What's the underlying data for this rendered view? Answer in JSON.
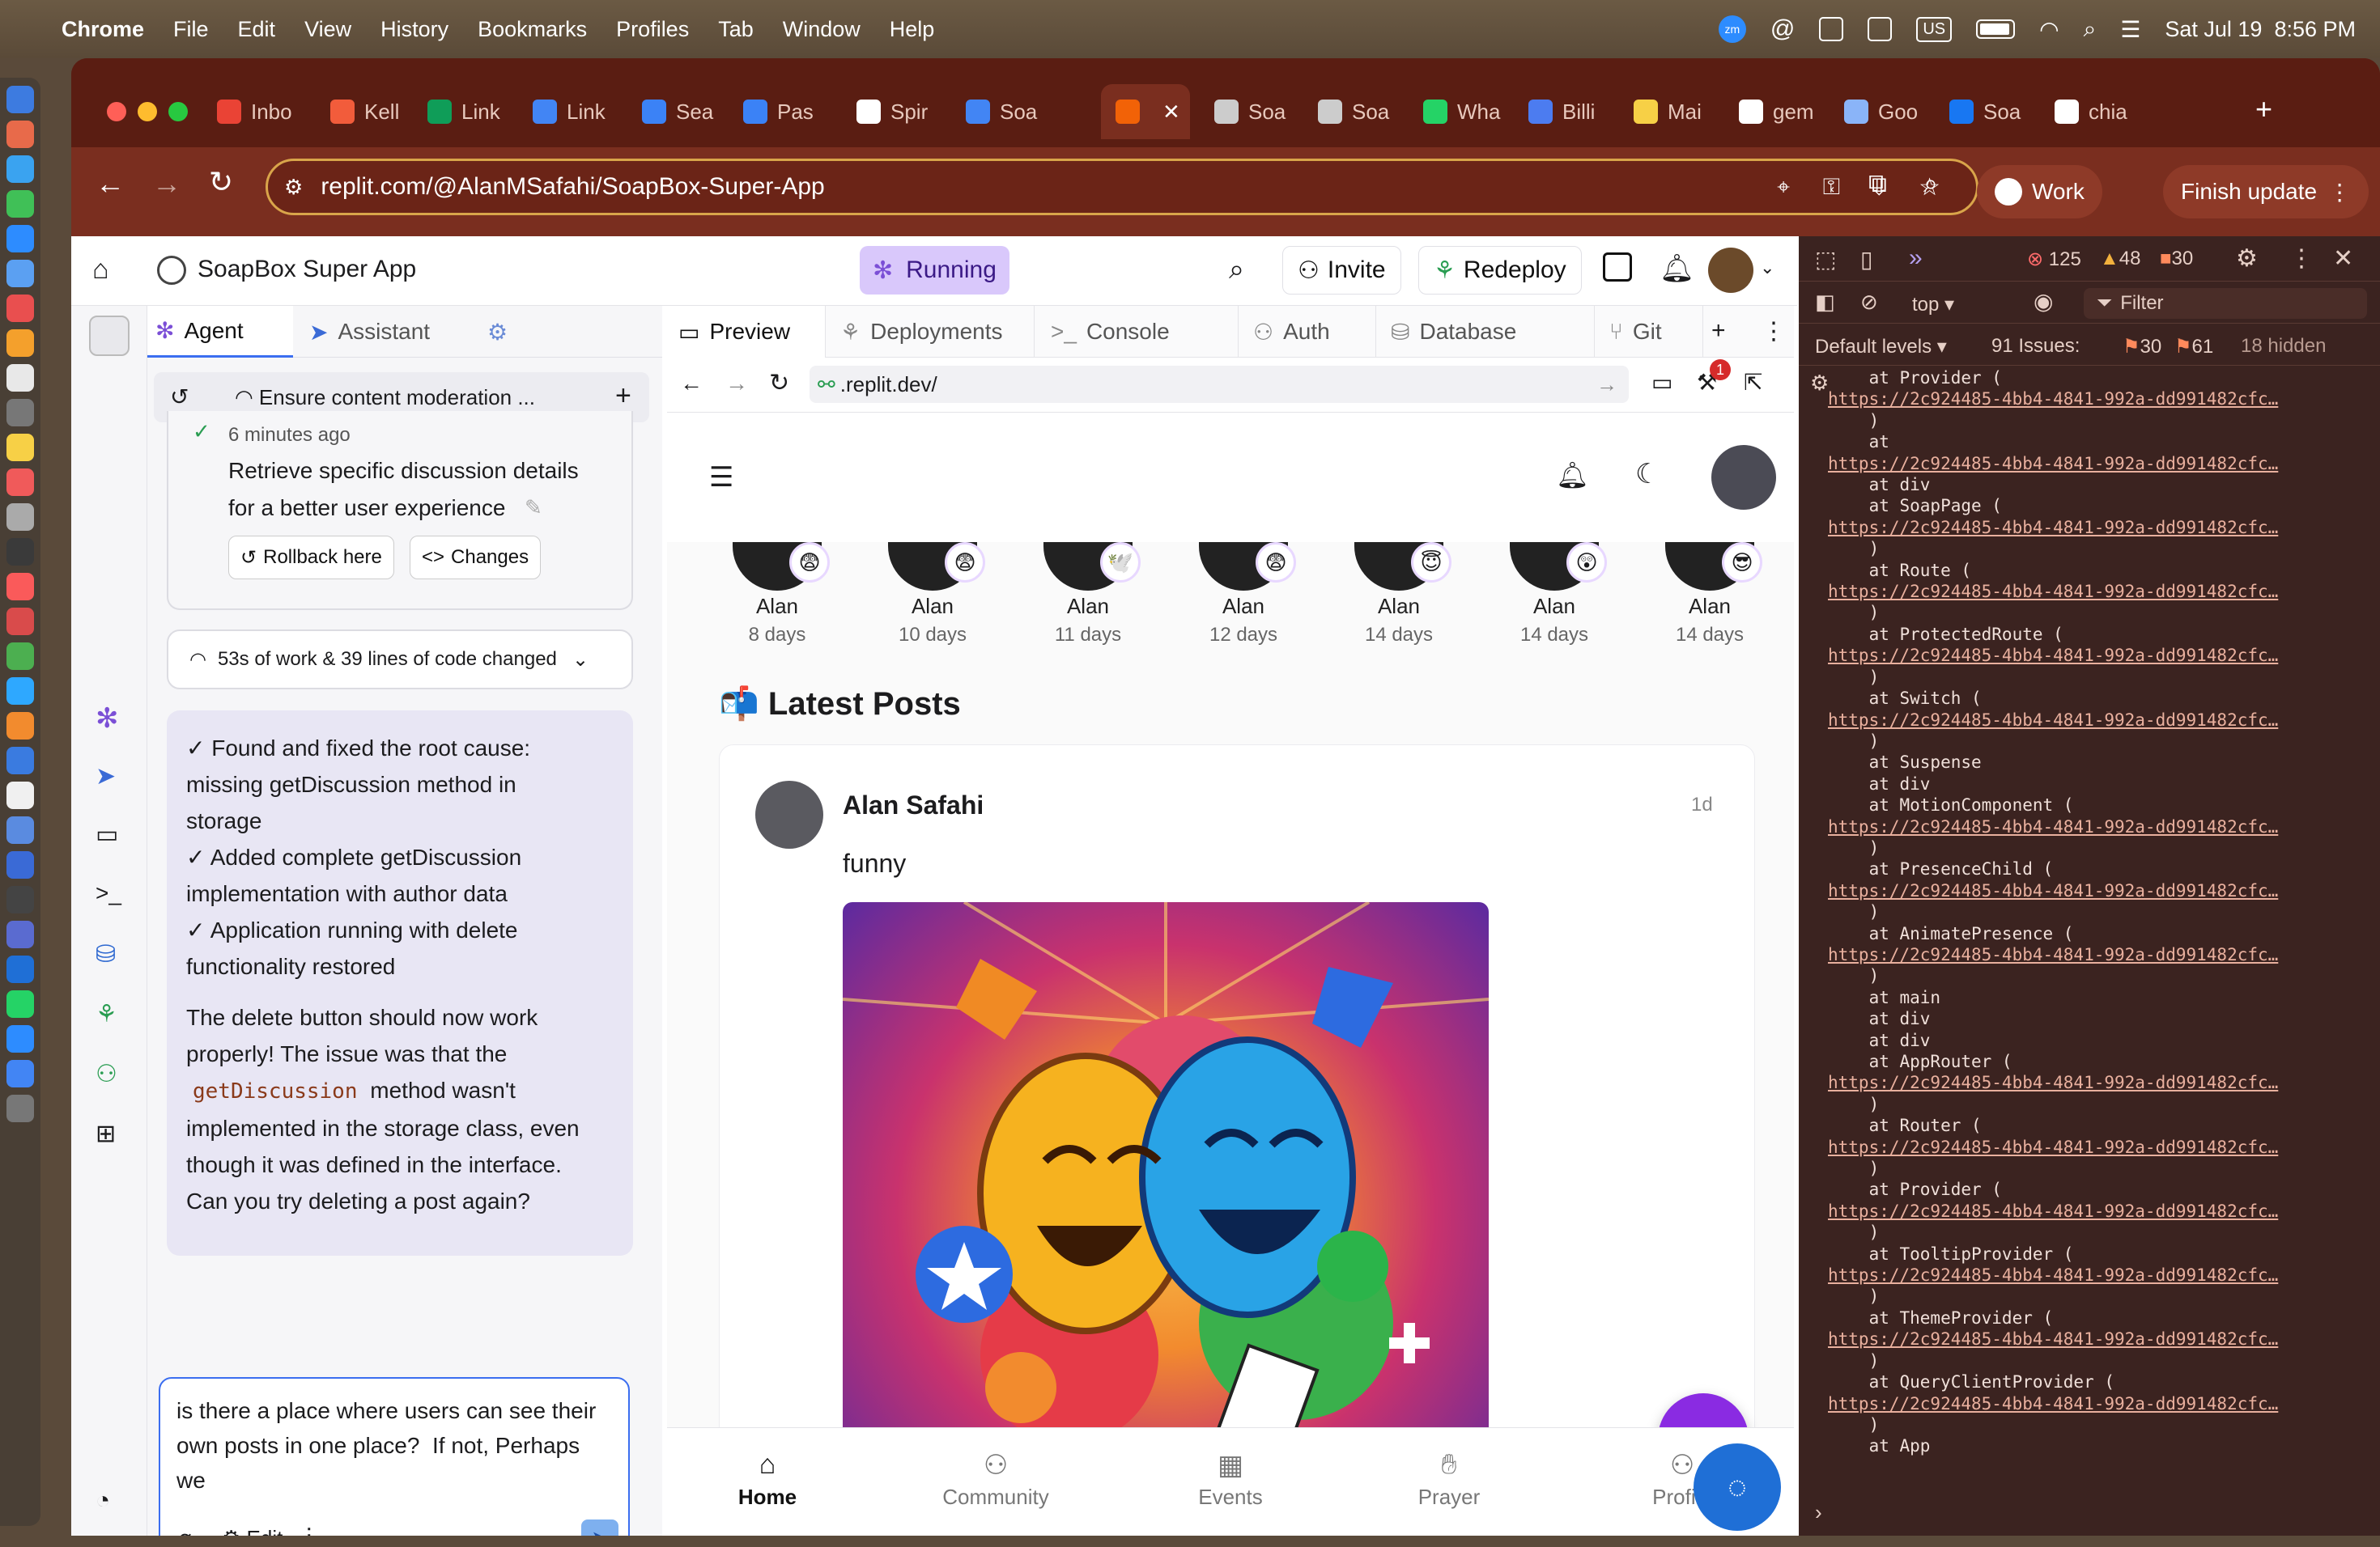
{
  "menubar": {
    "app": "Chrome",
    "items": [
      "File",
      "Edit",
      "View",
      "History",
      "Bookmarks",
      "Profiles",
      "Tab",
      "Window",
      "Help"
    ],
    "status_icons": [
      "zoom-icon",
      "threads-icon",
      "outlook-icon",
      "teams-icon",
      "keyboard-input-icon",
      "battery-icon",
      "wifi-icon",
      "spotlight-icon",
      "control-center-icon"
    ],
    "input_source": "US",
    "datetime": "Sat Jul 19  8:56 PM"
  },
  "tabs": [
    {
      "label": "Inbo",
      "color": "#ea4335"
    },
    {
      "label": "Kell",
      "color": "#f25c3b"
    },
    {
      "label": "Link",
      "color": "#0f9d58"
    },
    {
      "label": "Link",
      "color": "#4285f4"
    },
    {
      "label": "Sea",
      "color": "#3b82f6"
    },
    {
      "label": "Pas",
      "color": "#3b82f6"
    },
    {
      "label": "Spir",
      "color": "#ffffff"
    },
    {
      "label": "Soa",
      "color": "#4285f4"
    },
    {
      "label": "",
      "color": "#f26207"
    },
    {
      "label": "Soa",
      "color": "#cccccc"
    },
    {
      "label": "Soa",
      "color": "#cccccc"
    },
    {
      "label": "Wha",
      "color": "#25d366"
    },
    {
      "label": "Billi",
      "color": "#4c7cf0"
    },
    {
      "label": "Mai",
      "color": "#f7d046"
    },
    {
      "label": "gem",
      "color": "#ffffff"
    },
    {
      "label": "Goo",
      "color": "#8ab4f8"
    },
    {
      "label": "Soa",
      "color": "#1877f2"
    },
    {
      "label": "chia",
      "color": "#ffffff"
    }
  ],
  "address": {
    "url": "replit.com/@AlanMSafahi/SoapBox-Super-App",
    "profile": "Work",
    "update": "Finish update"
  },
  "replit": {
    "project_name": "SoapBox Super App",
    "run_status": "Running",
    "invite": "Invite",
    "redeploy": "Redeploy"
  },
  "agent_panel": {
    "tabs": [
      "Agent",
      "Assistant"
    ],
    "thread_title": "Ensure content moderation ...",
    "checkpoint_time": "6 minutes ago",
    "checkpoint_text_1": "Retrieve specific discussion details",
    "checkpoint_text_2": "for a better user experience",
    "rollback": "Rollback here",
    "changes": "Changes",
    "work_summary": "53s of work & 39 lines of code changed",
    "msg_lines": [
      "✓ Found and fixed the root cause:",
      "missing getDiscussion method in",
      "storage",
      "✓ Added complete getDiscussion",
      "implementation with author data",
      "✓ Application running with delete",
      "functionality restored"
    ],
    "msg2_line1": "The delete button should now work",
    "msg2_line2": "properly! The issue was that the",
    "msg2_code": "getDiscussion",
    "msg2_after_code": " method wasn't",
    "msg2_line4": "implemented in the storage class, even",
    "msg2_line5": "though it was defined in the interface.",
    "msg2_line6": "Can you try deleting a post again?",
    "input_line1": "is there a place where users can see their",
    "input_line2": "own posts in one place?  If not, Perhaps",
    "input_line3": "we",
    "edit": "Edit"
  },
  "preview": {
    "tabs": [
      "Preview",
      "Deployments",
      "Console",
      "Auth",
      "Database",
      "Git"
    ],
    "url": ".replit.dev/",
    "notification_count": "1",
    "stories": [
      {
        "name": "Alan",
        "ago": "8 days",
        "emoji": "😨"
      },
      {
        "name": "Alan",
        "ago": "10 days",
        "emoji": "😨"
      },
      {
        "name": "Alan",
        "ago": "11 days",
        "emoji": "🕊️"
      },
      {
        "name": "Alan",
        "ago": "12 days",
        "emoji": "😨"
      },
      {
        "name": "Alan",
        "ago": "14 days",
        "emoji": "😇"
      },
      {
        "name": "Alan",
        "ago": "14 days",
        "emoji": "😲"
      },
      {
        "name": "Alan",
        "ago": "14 days",
        "emoji": "😎"
      }
    ],
    "section_title": "📬 Latest Posts",
    "post_author": "Alan Safahi",
    "post_time": "1d",
    "post_text": "funny",
    "fab": "+",
    "bottom_nav": [
      "Home",
      "Community",
      "Events",
      "Prayer",
      "Profile"
    ]
  },
  "devtools": {
    "errors": "125",
    "warnings": "48",
    "info": "30",
    "context": "top",
    "filter_placeholder": "Filter",
    "levels": "Default levels",
    "issues_label": "91 Issues:",
    "issues_a": "30",
    "issues_b": "61",
    "hidden": "18 hidden",
    "link": "https://2c924485-4bb4-4841-992a-dd991482cfc…",
    "lines": [
      {
        "t": "    at Provider (",
        "clip": true
      },
      {
        "t": "link"
      },
      {
        "t": "    )"
      },
      {
        "t": "    at"
      },
      {
        "t": "link"
      },
      {
        "t": "    at div"
      },
      {
        "t": "    at SoapPage ("
      },
      {
        "t": "link"
      },
      {
        "t": "    )"
      },
      {
        "t": "    at Route ("
      },
      {
        "t": "link"
      },
      {
        "t": "    )"
      },
      {
        "t": "    at ProtectedRoute ("
      },
      {
        "t": "link"
      },
      {
        "t": "    )"
      },
      {
        "t": "    at Switch ("
      },
      {
        "t": "link"
      },
      {
        "t": "    )"
      },
      {
        "t": "    at Suspense"
      },
      {
        "t": "    at div"
      },
      {
        "t": "    at MotionComponent ("
      },
      {
        "t": "link"
      },
      {
        "t": "    )"
      },
      {
        "t": "    at PresenceChild ("
      },
      {
        "t": "link"
      },
      {
        "t": "    )"
      },
      {
        "t": "    at AnimatePresence ("
      },
      {
        "t": "link"
      },
      {
        "t": "    )"
      },
      {
        "t": "    at main"
      },
      {
        "t": "    at div"
      },
      {
        "t": "    at div"
      },
      {
        "t": "    at AppRouter ("
      },
      {
        "t": "link"
      },
      {
        "t": "    )"
      },
      {
        "t": "    at Router ("
      },
      {
        "t": "link"
      },
      {
        "t": "    )"
      },
      {
        "t": "    at Provider ("
      },
      {
        "t": "link"
      },
      {
        "t": "    )"
      },
      {
        "t": "    at TooltipProvider ("
      },
      {
        "t": "link"
      },
      {
        "t": "    )"
      },
      {
        "t": "    at ThemeProvider ("
      },
      {
        "t": "link"
      },
      {
        "t": "    )"
      },
      {
        "t": "    at QueryClientProvider ("
      },
      {
        "t": "link"
      },
      {
        "t": "    )"
      },
      {
        "t": "    at App"
      }
    ]
  }
}
